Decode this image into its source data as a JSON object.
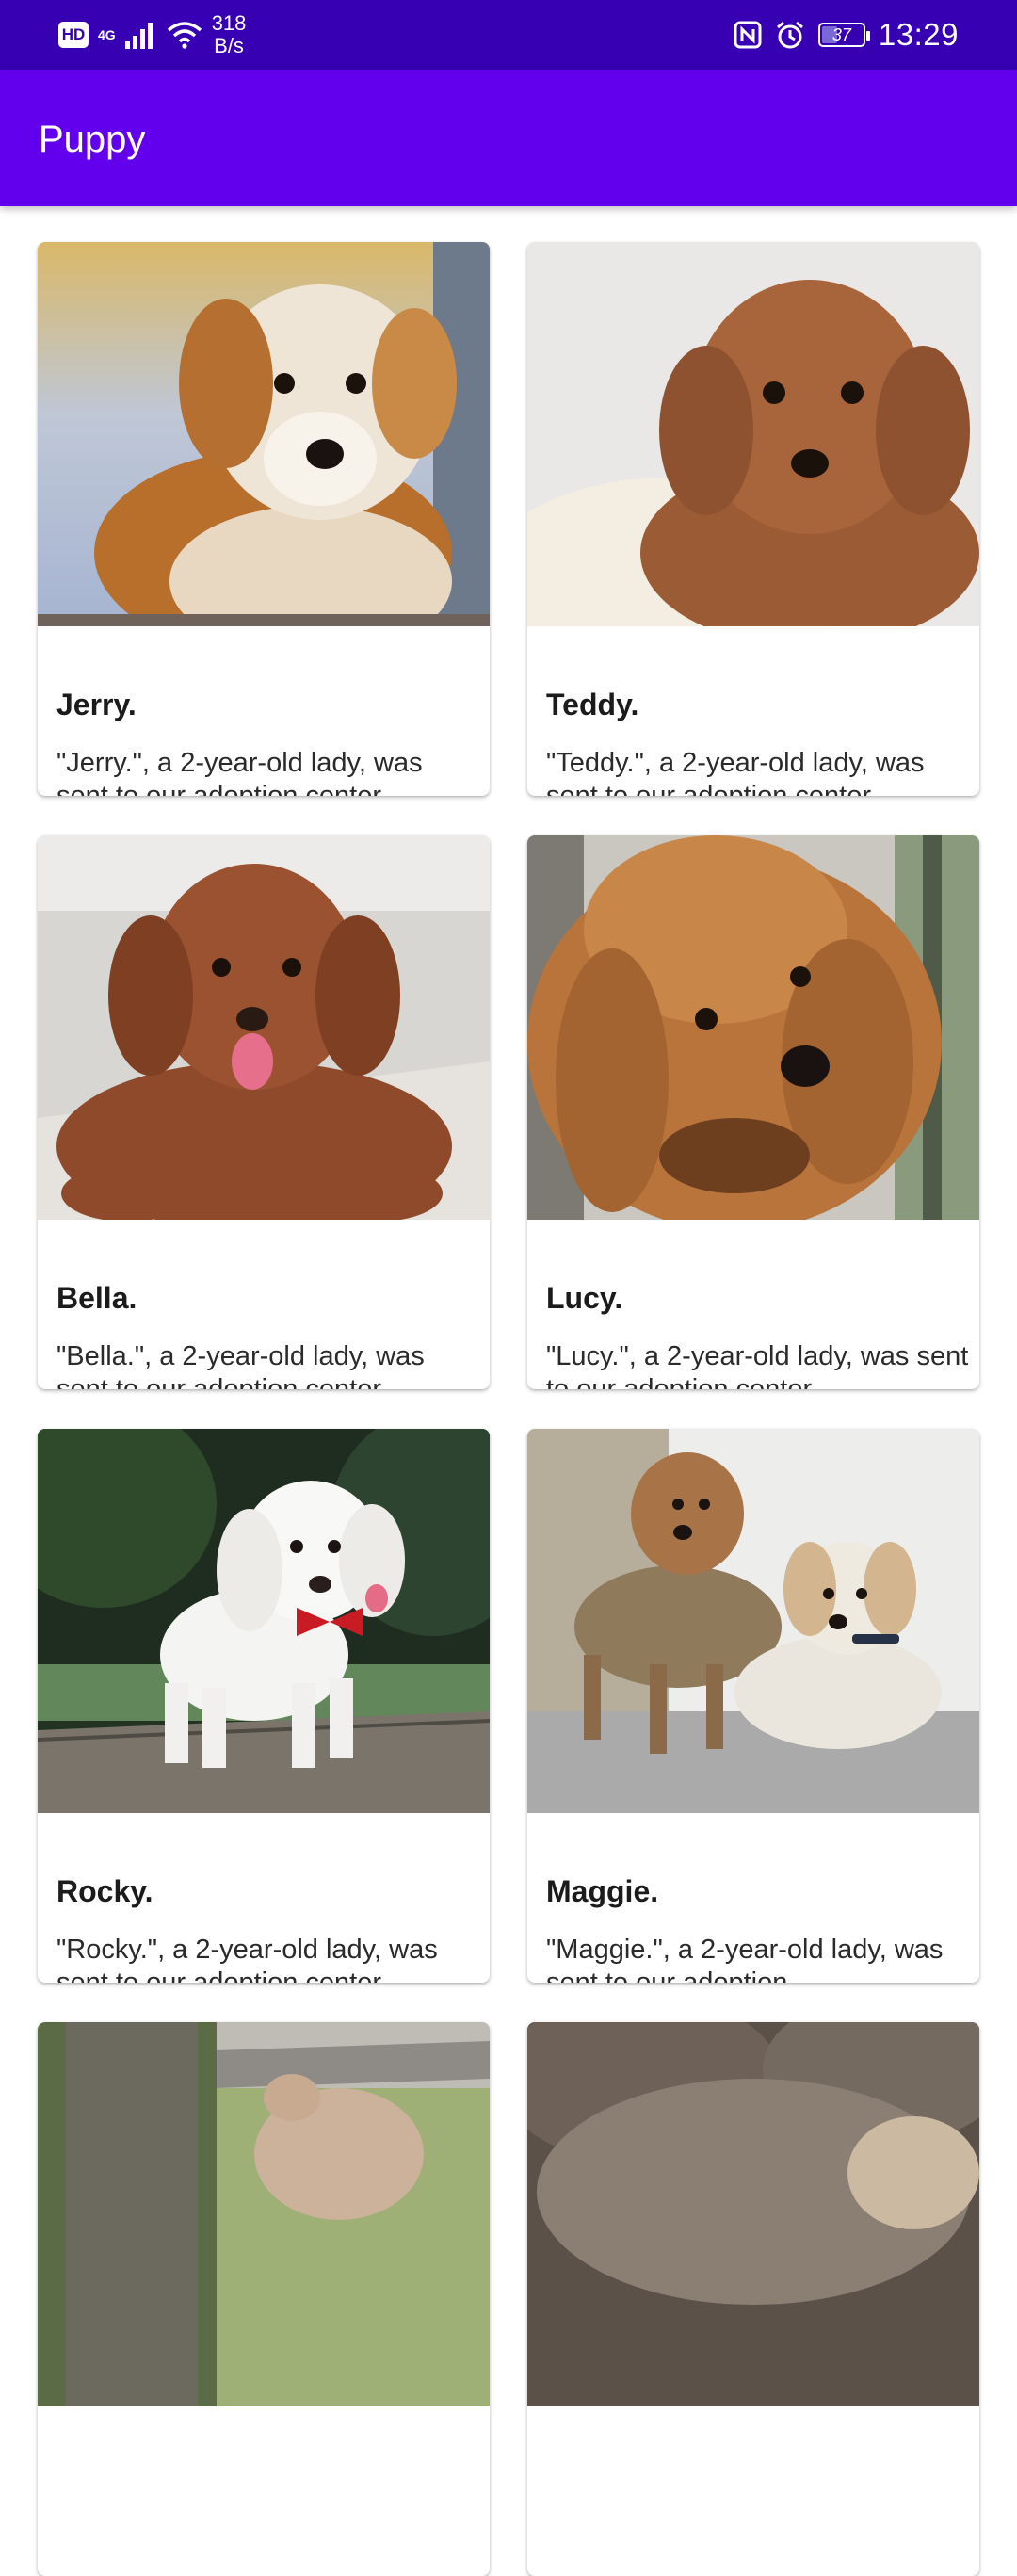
{
  "status_bar": {
    "hd": "HD",
    "network": "4G",
    "speed_value": "318",
    "speed_unit": "B/s",
    "battery": "37",
    "time": "13:29"
  },
  "app_bar": {
    "title": "Puppy"
  },
  "puppies": [
    {
      "name": "Jerry.",
      "description": "\"Jerry.\", a 2-year-old lady, was sent to our adoption center"
    },
    {
      "name": "Teddy.",
      "description": "\"Teddy.\", a 2-year-old lady, was sent to our adoption center"
    },
    {
      "name": "Bella.",
      "description": "\"Bella.\", a 2-year-old lady, was sent to our adoption center"
    },
    {
      "name": "Lucy.",
      "description": "\"Lucy.\", a 2-year-old lady, was sent to our adoption center"
    },
    {
      "name": "Rocky.",
      "description": "\"Rocky.\", a 2-year-old lady, was sent to our adoption center"
    },
    {
      "name": "Maggie.",
      "description": "\"Maggie.\", a 2-year-old lady, was sent to our adoption"
    },
    {
      "name": "",
      "description": ""
    },
    {
      "name": "",
      "description": ""
    }
  ]
}
